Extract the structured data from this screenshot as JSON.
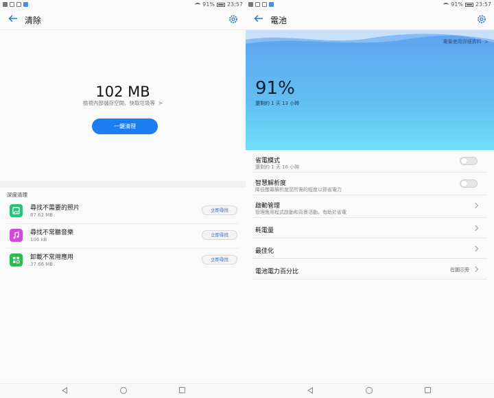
{
  "status": {
    "battery_pct": "91%",
    "time": "23:57"
  },
  "left": {
    "title": "清除",
    "storage_size": "102 MB",
    "storage_link": "檢視內部儲存空間、快取垃圾等",
    "clean_button": "一鍵清理",
    "section_label": "深度清理",
    "items": [
      {
        "name": "尋找不需要的照片",
        "size": "87.62 MB",
        "button": "立即尋找",
        "icon": "photo-icon"
      },
      {
        "name": "尋找不常聽音樂",
        "size": "106 kB",
        "button": "立即尋找",
        "icon": "music-icon"
      },
      {
        "name": "卸載不常用應用",
        "size": "37.66 MB",
        "button": "立即尋找",
        "icon": "apps-icon"
      }
    ]
  },
  "right": {
    "title": "電池",
    "usage_link": "電量使用詳細資料",
    "percent": "91%",
    "remaining": "還剩約 1 天 13 小時",
    "rows": {
      "power_saving": {
        "title": "省電模式",
        "sub": "還剩約 1 天 16 小時"
      },
      "smart_resolution": {
        "title": "智慧解析度",
        "sub": "降低螢幕解析度至所需的程度以節省電力"
      },
      "startup": {
        "title": "啟動管理",
        "sub": "管理應用程式啟動和背景活動，有助於省電"
      },
      "consumption": {
        "title": "耗電量"
      },
      "optimize": {
        "title": "最佳化"
      },
      "battery_percent": {
        "title": "電池電力百分比",
        "value": "在圖示旁"
      }
    }
  },
  "colors": {
    "accent": "#1e7cf2",
    "hero_top": "#5ea2ef",
    "hero_bottom": "#6fe0f7"
  }
}
